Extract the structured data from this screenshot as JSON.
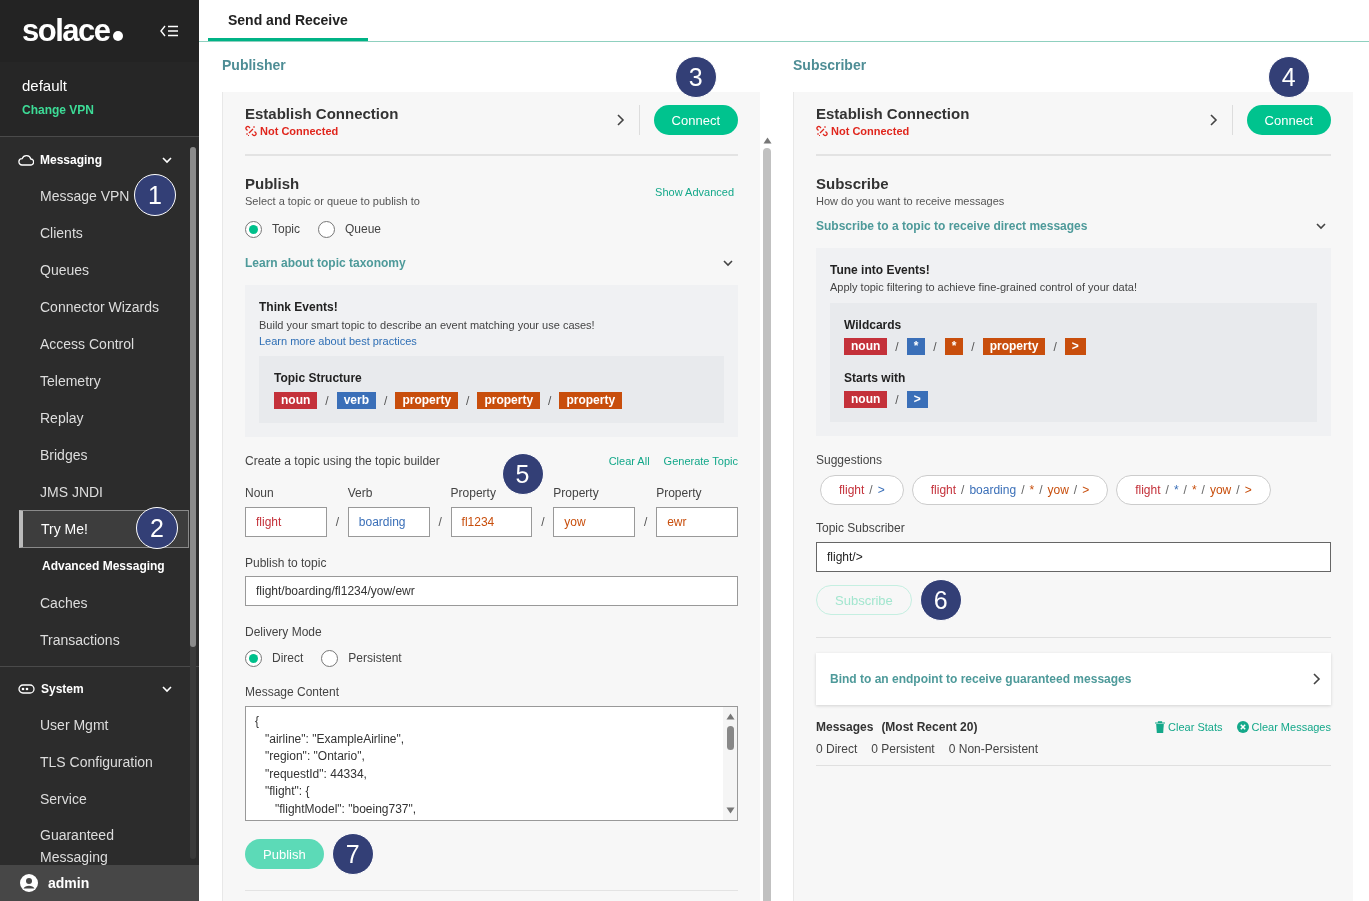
{
  "sidebar": {
    "logo": "solace",
    "vpn_name": "default",
    "change_vpn": "Change VPN",
    "groups": [
      {
        "label": "Messaging",
        "expanded": true,
        "items": [
          {
            "label": "Message VPN",
            "kind": "link",
            "selected": false,
            "callout": "1"
          },
          {
            "label": "Clients",
            "kind": "link",
            "selected": false
          },
          {
            "label": "Queues",
            "kind": "link",
            "selected": false
          },
          {
            "label": "Connector Wizards",
            "kind": "link",
            "selected": false
          },
          {
            "label": "Access Control",
            "kind": "link",
            "selected": false
          },
          {
            "label": "Telemetry",
            "kind": "link",
            "selected": false
          },
          {
            "label": "Replay",
            "kind": "link",
            "selected": false
          },
          {
            "label": "Bridges",
            "kind": "link",
            "selected": false
          },
          {
            "label": "JMS JNDI",
            "kind": "link",
            "selected": false
          },
          {
            "label": "Try Me!",
            "kind": "link",
            "selected": true,
            "callout": "2"
          },
          {
            "label": "Advanced Messaging",
            "kind": "subheader",
            "selected": false
          },
          {
            "label": "Caches",
            "kind": "link",
            "selected": false
          },
          {
            "label": "Transactions",
            "kind": "link",
            "selected": false
          }
        ]
      },
      {
        "label": "System",
        "expanded": true,
        "items": [
          {
            "label": "User Mgmt",
            "kind": "link",
            "selected": false
          },
          {
            "label": "TLS Configuration",
            "kind": "link",
            "selected": false
          },
          {
            "label": "Service",
            "kind": "link",
            "selected": false
          },
          {
            "label": "Guaranteed Messaging",
            "kind": "link",
            "selected": false
          }
        ]
      }
    ],
    "user": "admin"
  },
  "tabs": [
    {
      "label": "Send and Receive",
      "selected": true
    }
  ],
  "publisher": {
    "title": "Publisher",
    "connection": {
      "title": "Establish Connection",
      "status": "Not Connected",
      "button": "Connect",
      "callout": "3"
    },
    "publish": {
      "title": "Publish",
      "subtitle": "Select a topic or queue to publish to",
      "show_advanced": "Show Advanced",
      "destination": [
        {
          "label": "Topic",
          "selected": true
        },
        {
          "label": "Queue",
          "selected": false
        }
      ],
      "taxonomy": {
        "label": "Learn about topic taxonomy",
        "expanded": true,
        "title": "Think Events!",
        "text": "Build your smart topic to describe an event matching your use cases!",
        "link": "Learn more about best practices",
        "structure": {
          "title": "Topic Structure",
          "separator": "/",
          "tags": [
            {
              "text": "noun",
              "kind": "noun"
            },
            {
              "text": "verb",
              "kind": "verb"
            },
            {
              "text": "property",
              "kind": "property"
            },
            {
              "text": "property",
              "kind": "property"
            },
            {
              "text": "property",
              "kind": "property"
            }
          ]
        }
      },
      "builder": {
        "label": "Create a topic using the topic builder",
        "actions": [
          "Clear All",
          "Generate Topic"
        ],
        "separator": "/",
        "fields": [
          {
            "label": "Noun",
            "value": "flight",
            "kind": "noun"
          },
          {
            "label": "Verb",
            "value": "boarding",
            "kind": "verb"
          },
          {
            "label": "Property",
            "value": "fl1234",
            "kind": "property",
            "callout": "5"
          },
          {
            "label": "Property",
            "value": "yow",
            "kind": "property"
          },
          {
            "label": "Property",
            "value": "ewr",
            "kind": "property"
          }
        ]
      },
      "topic": {
        "label": "Publish to topic",
        "value": "flight/boarding/fl1234/yow/ewr"
      },
      "delivery": {
        "label": "Delivery Mode",
        "options": [
          {
            "label": "Direct",
            "selected": true
          },
          {
            "label": "Persistent",
            "selected": false
          }
        ]
      },
      "content": {
        "label": "Message Content",
        "value": "{\n   \"airline\": \"ExampleAirline\",\n   \"region\": \"Ontario\",\n   \"requestId\": 44334,\n   \"flight\": {\n      \"flightModel\": \"boeing737\","
      },
      "button": {
        "label": "Publish",
        "disabled": true,
        "callout": "7"
      }
    }
  },
  "subscriber": {
    "title": "Subscriber",
    "connection": {
      "title": "Establish Connection",
      "status": "Not Connected",
      "button": "Connect",
      "callout": "4"
    },
    "subscribe": {
      "title": "Subscribe",
      "subtitle": "How do you want to receive messages",
      "direct": {
        "label": "Subscribe to a topic to receive direct messages",
        "expanded": true,
        "title": "Tune into Events!",
        "text": "Apply topic filtering to achieve fine-grained control of your data!",
        "separator": "/",
        "groups": [
          {
            "title": "Wildcards",
            "tags": [
              {
                "text": "noun",
                "kind": "noun"
              },
              {
                "text": "*",
                "kind": "verb"
              },
              {
                "text": "*",
                "kind": "property"
              },
              {
                "text": "property",
                "kind": "property"
              },
              {
                "text": ">",
                "kind": "property"
              }
            ]
          },
          {
            "title": "Starts with",
            "tags": [
              {
                "text": "noun",
                "kind": "noun"
              },
              {
                "text": ">",
                "kind": "verb"
              }
            ]
          }
        ]
      },
      "suggestions": {
        "label": "Suggestions",
        "separator": "/",
        "chips": [
          {
            "segments": [
              {
                "text": "flight",
                "kind": "noun"
              },
              {
                "text": ">",
                "kind": "verb"
              }
            ]
          },
          {
            "segments": [
              {
                "text": "flight",
                "kind": "noun"
              },
              {
                "text": "boarding",
                "kind": "verb"
              },
              {
                "text": "*",
                "kind": "property"
              },
              {
                "text": "yow",
                "kind": "property"
              },
              {
                "text": ">",
                "kind": "property"
              }
            ]
          },
          {
            "segments": [
              {
                "text": "flight",
                "kind": "noun"
              },
              {
                "text": "*",
                "kind": "verb"
              },
              {
                "text": "*",
                "kind": "property"
              },
              {
                "text": "yow",
                "kind": "property"
              },
              {
                "text": ">",
                "kind": "property"
              }
            ]
          }
        ]
      },
      "topic": {
        "label": "Topic Subscriber",
        "value": "flight/>"
      },
      "button": {
        "label": "Subscribe",
        "disabled": true,
        "callout": "6"
      }
    },
    "bind": {
      "label": "Bind to an endpoint to receive guaranteed messages"
    },
    "messages": {
      "title": "Messages",
      "subtitle": "(Most Recent 20)",
      "actions": [
        "Clear Stats",
        "Clear Messages"
      ],
      "stats": [
        "0 Direct",
        "0 Persistent",
        "0 Non-Persistent"
      ]
    }
  }
}
